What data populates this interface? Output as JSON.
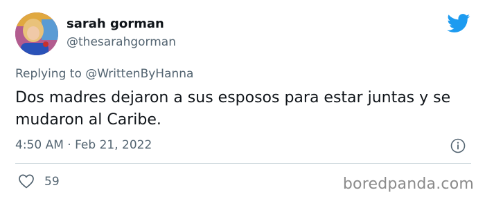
{
  "author": {
    "display_name": "sarah gorman",
    "handle": "@thesarahgorman",
    "avatar_icon": "profile-photo"
  },
  "reply": {
    "prefix": "Replying to ",
    "mention": "@WrittenByHanna"
  },
  "tweet": {
    "text": "Dos madres dejaron a sus esposos para estar juntas y se mudaron al Caribe."
  },
  "meta": {
    "timestamp": "4:50 AM · Feb 21, 2022"
  },
  "engagement": {
    "likes": "59"
  },
  "watermark": {
    "text": "boredpanda.com"
  },
  "icons": {
    "brand": "twitter-bird-icon",
    "info": "info-icon",
    "like": "heart-icon"
  },
  "colors": {
    "twitter_blue": "#1d9bf0",
    "secondary_text": "#536471",
    "primary_text": "#0f1419",
    "divider": "#cfd9de"
  }
}
